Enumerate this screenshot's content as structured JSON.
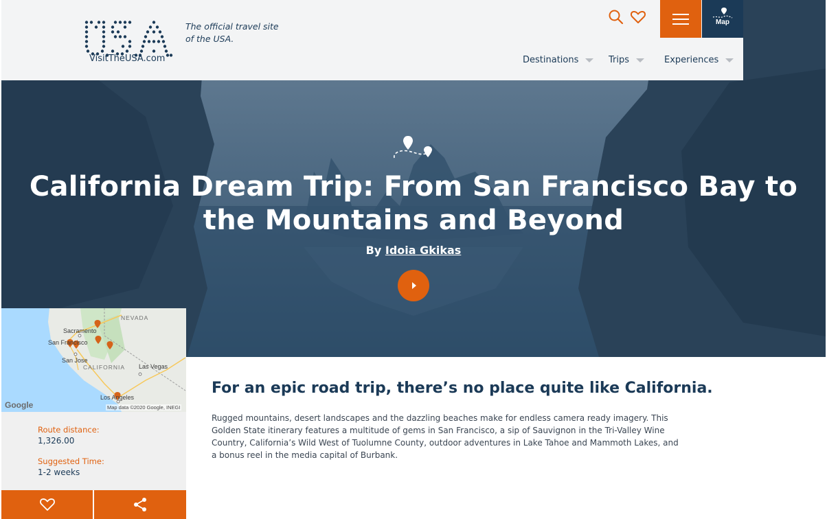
{
  "brand": {
    "logo_text": "VisitTheUSA.com",
    "tagline": "The official travel site of the USA.",
    "accent_color": "#e0610f",
    "navy_color": "#1b3a57"
  },
  "header": {
    "search_icon": "search-icon",
    "favorites_icon": "heart-icon",
    "menu_icon": "hamburger-icon",
    "map_label": "Map",
    "nav": [
      {
        "label": "Destinations"
      },
      {
        "label": "Trips"
      },
      {
        "label": "Experiences"
      }
    ]
  },
  "hero": {
    "title": "California Dream Trip: From San Francisco Bay to the Mountains and Beyond",
    "byline_prefix": "By",
    "author": "Idoia Gkikas",
    "play_icon": "play-icon"
  },
  "map": {
    "labels": {
      "nevada": "NEVADA",
      "sacramento": "Sacramento",
      "san_francisco": "San Francisco",
      "san_jose": "San Jose",
      "california": "CALIFORNIA",
      "las_vegas": "Las Vegas",
      "los_angeles": "Los Angeles"
    },
    "google": "Google",
    "credit": "Map data ©2020 Google, INEGI"
  },
  "route": {
    "distance_label": "Route distance:",
    "distance_value": "1,326.00",
    "time_label": "Suggested Time:",
    "time_value": "1-2 weeks"
  },
  "actions": {
    "favorite_icon": "heart-icon",
    "share_icon": "share-icon"
  },
  "article": {
    "headline": "For an epic road trip, there’s no place quite like California.",
    "body": "Rugged mountains, desert landscapes and the dazzling beaches make for endless camera ready imagery. This Golden State itinerary features a multitude of gems in San Francisco, a sip of Sauvignon in the Tri-Valley Wine Country, California’s Wild West of Tuolumne County, outdoor adventures in Lake Tahoe and Mammoth Lakes, and a bonus reel in the media capital of Burbank."
  }
}
